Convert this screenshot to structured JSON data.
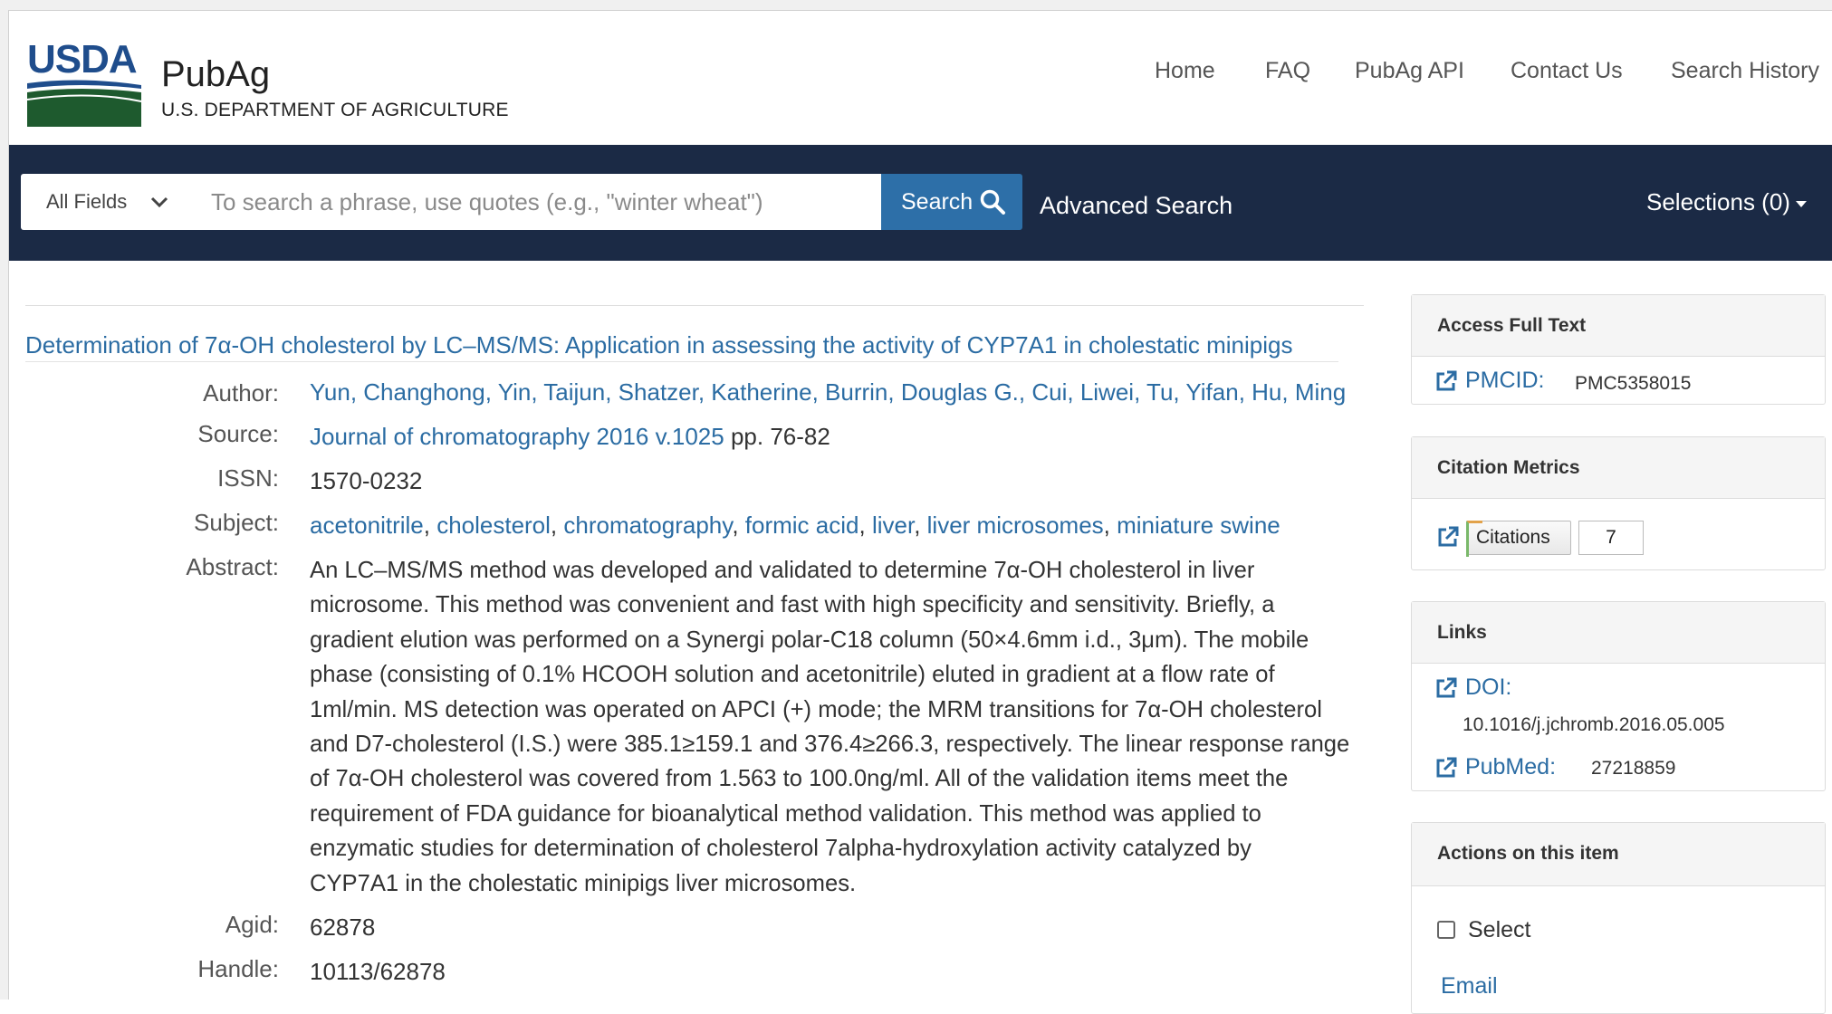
{
  "colors": {
    "nav_bg": "#1b2a45",
    "link": "#2b6ca3",
    "search_button": "#2d6fa8",
    "usda_green": "#1e5a2e",
    "usda_blue": "#1f4d8c"
  },
  "brand": {
    "logo_text": "USDA",
    "name": "PubAg",
    "subtitle": "U.S. DEPARTMENT OF AGRICULTURE"
  },
  "nav": {
    "items": [
      "Home",
      "FAQ",
      "PubAg API",
      "Contact Us",
      "Search History"
    ]
  },
  "search": {
    "field_select": "All Fields",
    "placeholder": "To search a phrase, use quotes (e.g., \"winter wheat\")",
    "button_label": "Search",
    "advanced_label": "Advanced Search",
    "selections_label": "Selections (0)"
  },
  "record": {
    "title": "Determination of 7α-OH cholesterol by LC–MS/MS: Application in assessing the activity of CYP7A1 in cholestatic minipigs",
    "labels": {
      "author": "Author:",
      "source": "Source:",
      "issn": "ISSN:",
      "subject": "Subject:",
      "abstract": "Abstract:",
      "agid": "Agid:",
      "handle": "Handle:"
    },
    "author": "Yun, Changhong, Yin, Taijun, Shatzer, Katherine, Burrin, Douglas G., Cui, Liwei, Tu, Yifan, Hu, Ming",
    "source_link": "Journal of chromatography 2016 v.1025",
    "source_pages": "pp. 76-82",
    "issn": "1570-0232",
    "subjects": [
      "acetonitrile",
      "cholesterol",
      "chromatography",
      "formic acid",
      "liver",
      "liver microsomes",
      "miniature swine"
    ],
    "abstract_lines": [
      "An LC–MS/MS method was developed and validated to determine 7α-OH cholesterol in liver",
      "microsome. This method was convenient and fast with high specificity and sensitivity. Briefly, a",
      "gradient elution was performed on a Synergi polar-C18 column (50×4.6mm i.d., 3μm). The mobile",
      "phase (consisting of 0.1% HCOOH solution and acetonitrile) eluted in gradient at a flow rate of",
      "1ml/min. MS detection was operated on APCI (+) mode; the MRM transitions for 7α-OH cholesterol",
      "and D7-cholesterol (I.S.) were 385.1≥159.1 and 376.4≥266.3, respectively. The linear response range",
      "of 7α-OH cholesterol was covered from 1.563 to 100.0ng/ml. All of the validation items meet the",
      "requirement of FDA guidance for bioanalytical method validation. This method was applied to",
      "enzymatic studies for determination of cholesterol 7alpha-hydroxylation activity catalyzed by",
      "CYP7A1 in the cholestatic minipigs liver microsomes."
    ],
    "agid": "62878",
    "handle": "10113/62878"
  },
  "sidebar": {
    "access": {
      "heading": "Access Full Text",
      "pmcid_label": "PMCID:",
      "pmcid_value": "PMC5358015"
    },
    "metrics": {
      "heading": "Citation Metrics",
      "badge_label": "Citations",
      "count": "7"
    },
    "links": {
      "heading": "Links",
      "doi_label": "DOI:",
      "doi_value": "10.1016/j.jchromb.2016.05.005",
      "pubmed_label": "PubMed:",
      "pubmed_value": "27218859"
    },
    "actions": {
      "heading": "Actions on this item",
      "select_label": "Select",
      "email_label": "Email"
    }
  }
}
